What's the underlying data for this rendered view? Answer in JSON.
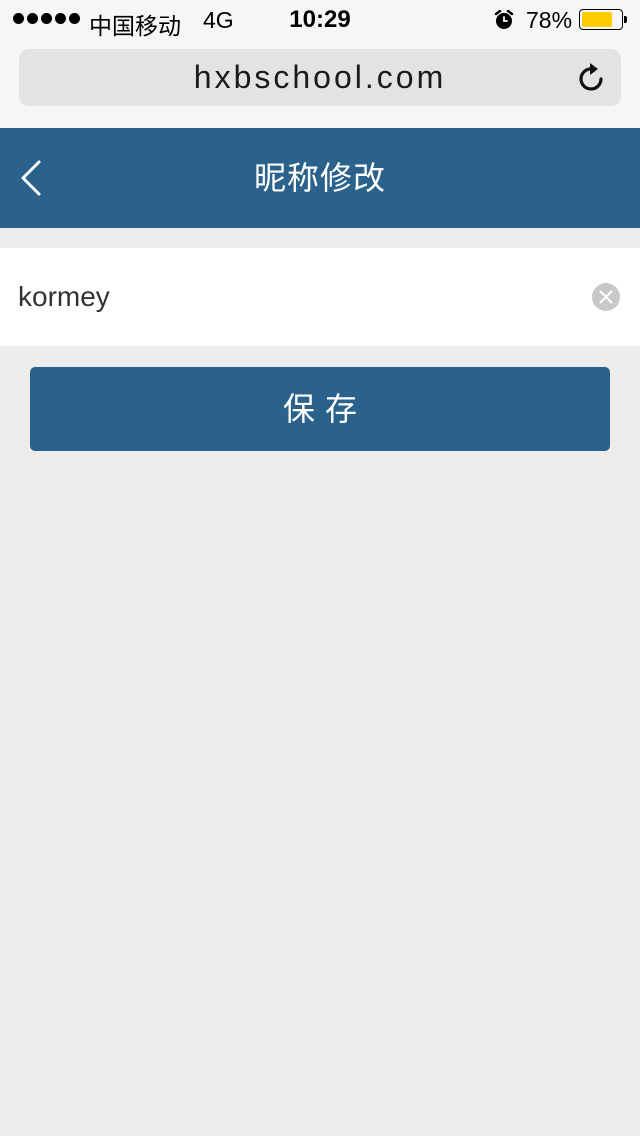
{
  "status_bar": {
    "carrier": "中国移动",
    "network": "4G",
    "time": "10:29",
    "battery_percent": "78%",
    "battery_level": 0.78,
    "battery_color": "#ffcc00",
    "alarm_icon": "alarm-clock-icon"
  },
  "browser": {
    "url": "hxbschool.com",
    "reload_icon": "reload-icon"
  },
  "header": {
    "title": "昵称修改",
    "back_icon": "chevron-left-icon",
    "color": "#2b628c"
  },
  "form": {
    "nickname_value": "kormey",
    "clear_icon": "clear-circle-icon"
  },
  "actions": {
    "save_label": "保存",
    "color": "#2b628c"
  }
}
